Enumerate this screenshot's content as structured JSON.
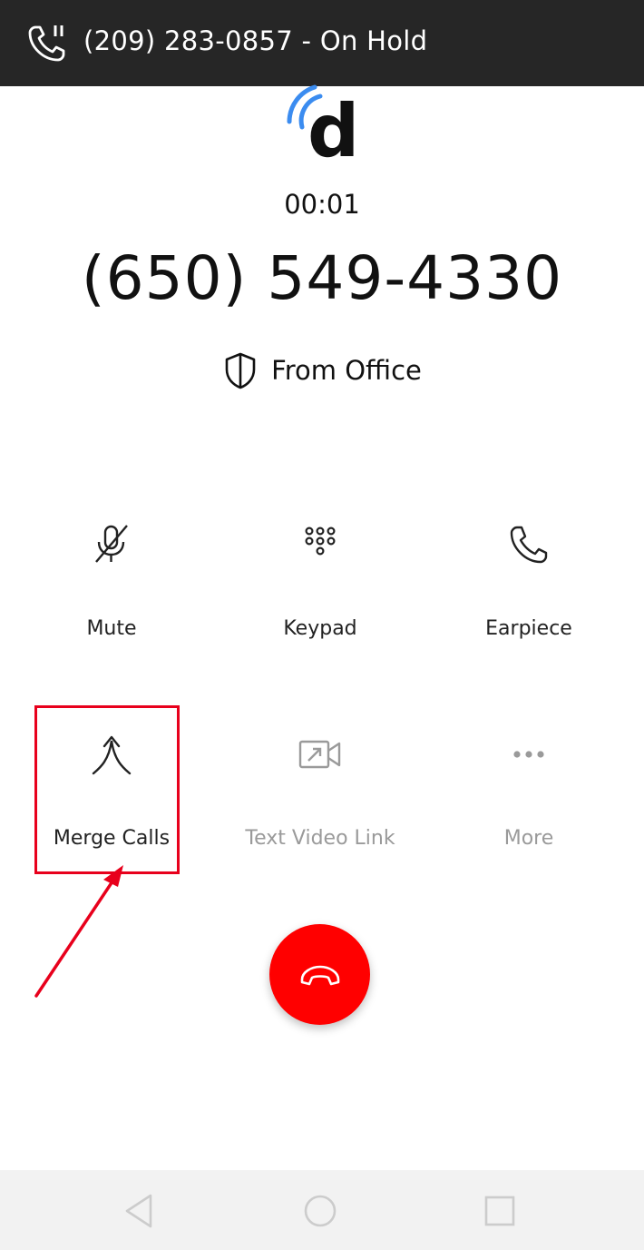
{
  "hold_banner": {
    "text": "(209) 283-0857 - On Hold",
    "icon": "phone-hold-icon"
  },
  "logo": {
    "letter": "d",
    "accent_color": "#3b8cf0"
  },
  "call": {
    "duration": "00:01",
    "number": "(650) 549-4330",
    "source_label": "From Office",
    "source_icon": "shield-icon"
  },
  "actions": [
    {
      "label": "Mute",
      "icon": "mic-off-icon",
      "enabled": true
    },
    {
      "label": "Keypad",
      "icon": "keypad-icon",
      "enabled": true
    },
    {
      "label": "Earpiece",
      "icon": "phone-icon",
      "enabled": true
    },
    {
      "label": "Merge Calls",
      "icon": "merge-icon",
      "enabled": true
    },
    {
      "label": "Text Video Link",
      "icon": "video-link-icon",
      "enabled": false
    },
    {
      "label": "More",
      "icon": "more-icon",
      "enabled": false
    }
  ],
  "end_call": {
    "icon": "hang-up-icon",
    "color": "#ff0000"
  },
  "annotation": {
    "color": "#e8001c"
  },
  "system_nav": [
    {
      "icon": "back-icon"
    },
    {
      "icon": "home-icon"
    },
    {
      "icon": "recents-icon"
    }
  ]
}
